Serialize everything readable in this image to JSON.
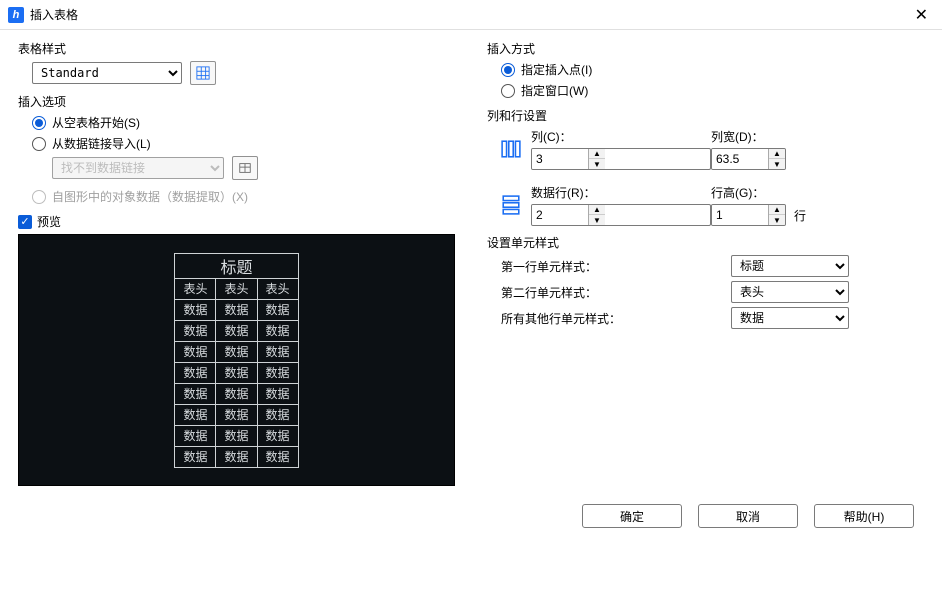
{
  "window": {
    "title": "插入表格"
  },
  "tablestyle": {
    "group_label": "表格样式",
    "value": "Standard"
  },
  "insert_options": {
    "group_label": "插入选项",
    "opt_blank": "从空表格开始(S)",
    "opt_link": "从数据链接导入(L)",
    "link_dropdown": "找不到数据链接",
    "opt_extract": "自图形中的对象数据（数据提取）(X)"
  },
  "preview": {
    "label": "预览",
    "title_cell": "标题",
    "header_cell": "表头",
    "data_cell": "数据"
  },
  "insert_mode": {
    "group_label": "插入方式",
    "opt_point": "指定插入点(I)",
    "opt_window": "指定窗口(W)"
  },
  "rowcol": {
    "group_label": "列和行设置",
    "col_label": "列(C)：",
    "col_value": "3",
    "colw_label": "列宽(D)：",
    "colw_value": "63.5",
    "datarow_label": "数据行(R)：",
    "datarow_value": "2",
    "rowh_label": "行高(G)：",
    "rowh_value": "1",
    "rowh_unit": "行"
  },
  "cellstyle": {
    "group_label": "设置单元样式",
    "row1_label": "第一行单元样式：",
    "row1_value": "标题",
    "row2_label": "第二行单元样式：",
    "row2_value": "表头",
    "other_label": "所有其他行单元样式：",
    "other_value": "数据"
  },
  "buttons": {
    "ok": "确定",
    "cancel": "取消",
    "help": "帮助(H)"
  }
}
